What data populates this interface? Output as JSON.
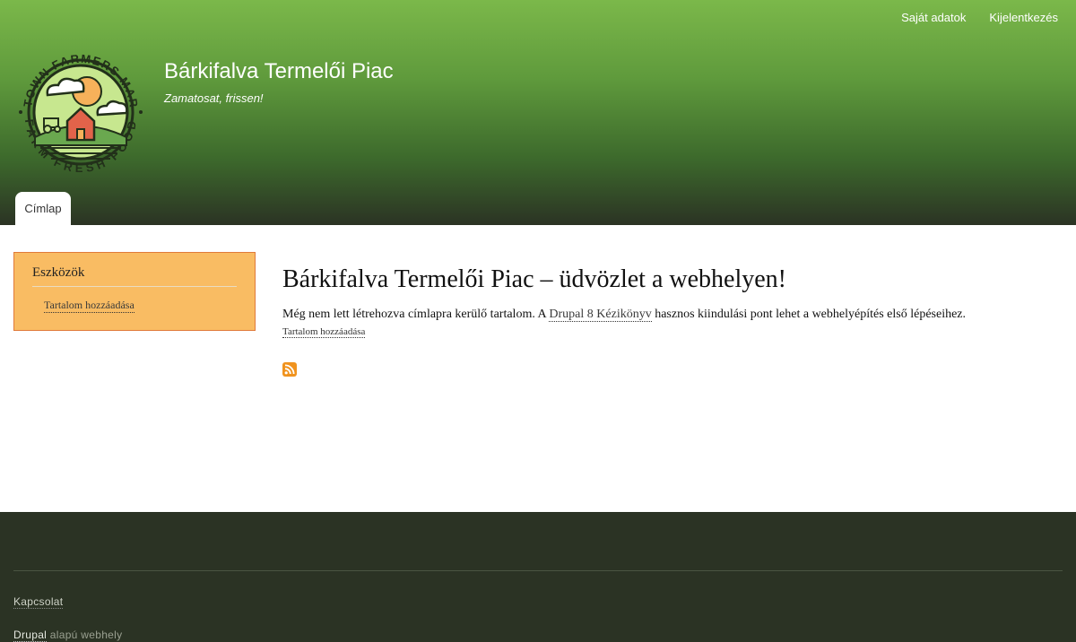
{
  "header": {
    "secondary_menu": [
      {
        "label": "Saját adatok"
      },
      {
        "label": "Kijelentkezés"
      }
    ],
    "site_name": "Bárkifalva Termelői Piac",
    "site_slogan": "Zamatosat, frissen!",
    "logo": {
      "icon": "farmers-market-logo",
      "top_text": "ANYTOWN FARMERS MARKET",
      "bottom_text": "FARM FRESH FOOD"
    },
    "tabs": [
      {
        "label": "Címlap"
      }
    ]
  },
  "sidebar": {
    "title": "Eszközök",
    "links": [
      {
        "label": "Tartalom hozzáadása"
      }
    ]
  },
  "main": {
    "title": "Bárkifalva Termelői Piac – üdvözlet a webhelyen!",
    "intro_before": "Még nem lett létrehozva címlapra kerülő tartalom. A ",
    "intro_link": "Drupal 8 Kézikönyv",
    "intro_after": " hasznos kiindulási pont lehet a webhelyépítés első lépéseihez.",
    "add_content_link": "Tartalom hozzáadása",
    "feed_icon": "rss-icon"
  },
  "footer": {
    "contact_link": "Kapcsolat",
    "powered_link": "Drupal",
    "powered_text": " alapú webhely"
  },
  "colors": {
    "header_top": "#7bb84a",
    "header_bottom": "#2b3324",
    "sidebar_bg": "#f9bc63",
    "sidebar_border": "#e07a3a",
    "footer_bg": "#2b3324",
    "rss": "#f0931e"
  }
}
